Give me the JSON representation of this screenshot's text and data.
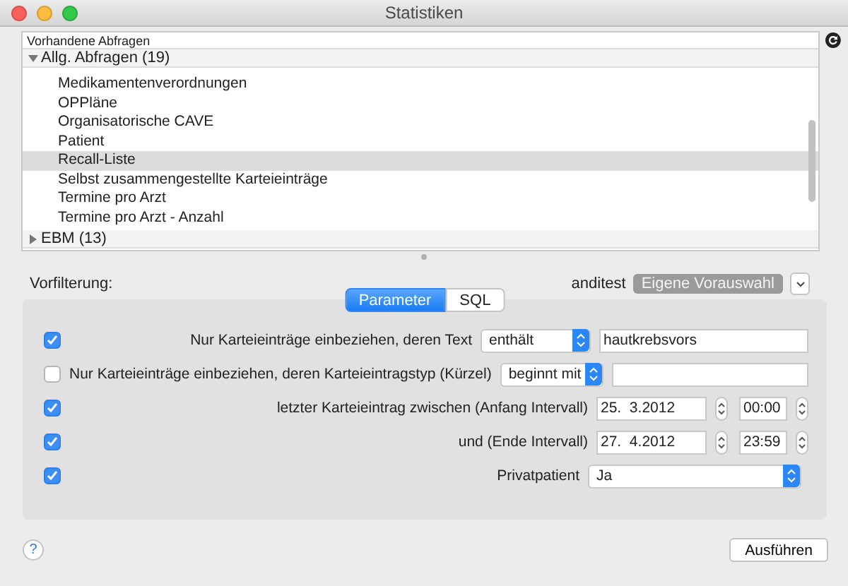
{
  "window": {
    "title": "Statistiken"
  },
  "query_list": {
    "header": "Vorhandene Abfragen",
    "groups": [
      {
        "label": "Allg. Abfragen (19)",
        "expanded": true,
        "children": [
          {
            "label": "Medikamentenverordnungen",
            "selected": false
          },
          {
            "label": "OPPläne",
            "selected": false
          },
          {
            "label": "Organisatorische CAVE",
            "selected": false
          },
          {
            "label": "Patient",
            "selected": false
          },
          {
            "label": "Recall-Liste",
            "selected": true
          },
          {
            "label": "Selbst zusammengestellte Karteieinträge",
            "selected": false
          },
          {
            "label": "Termine pro Arzt",
            "selected": false
          },
          {
            "label": "Termine pro Arzt - Anzahl",
            "selected": false
          }
        ]
      },
      {
        "label": "EBM (13)",
        "expanded": false
      }
    ]
  },
  "prefilter": {
    "label": "Vorfilterung:",
    "user": "anditest",
    "preset": "Eigene Vorauswahl"
  },
  "tabs": [
    {
      "label": "Parameter",
      "selected": true
    },
    {
      "label": "SQL",
      "selected": false
    }
  ],
  "parameters": [
    {
      "kind": "text_filter",
      "checked": true,
      "label": "Nur Karteieinträge einbeziehen, deren Text",
      "operator": "enthält",
      "value": "hautkrebsvors"
    },
    {
      "kind": "text_filter",
      "checked": false,
      "label": "Nur Karteieinträge einbeziehen, deren Karteieintragstyp (Kürzel)",
      "operator": "beginnt mit"
    },
    {
      "kind": "date_time",
      "checked": true,
      "label": "letzter Karteieintrag zwischen (Anfang Intervall)",
      "date": "25.  3.2012",
      "time": "00:00"
    },
    {
      "kind": "date_time",
      "checked": true,
      "label": "und (Ende Intervall)",
      "date": "27.  4.2012",
      "time": "23:59"
    },
    {
      "kind": "choice",
      "checked": true,
      "label": "Privatpatient",
      "value": "Ja"
    }
  ],
  "buttons": {
    "help": "?",
    "run": "Ausführen"
  }
}
